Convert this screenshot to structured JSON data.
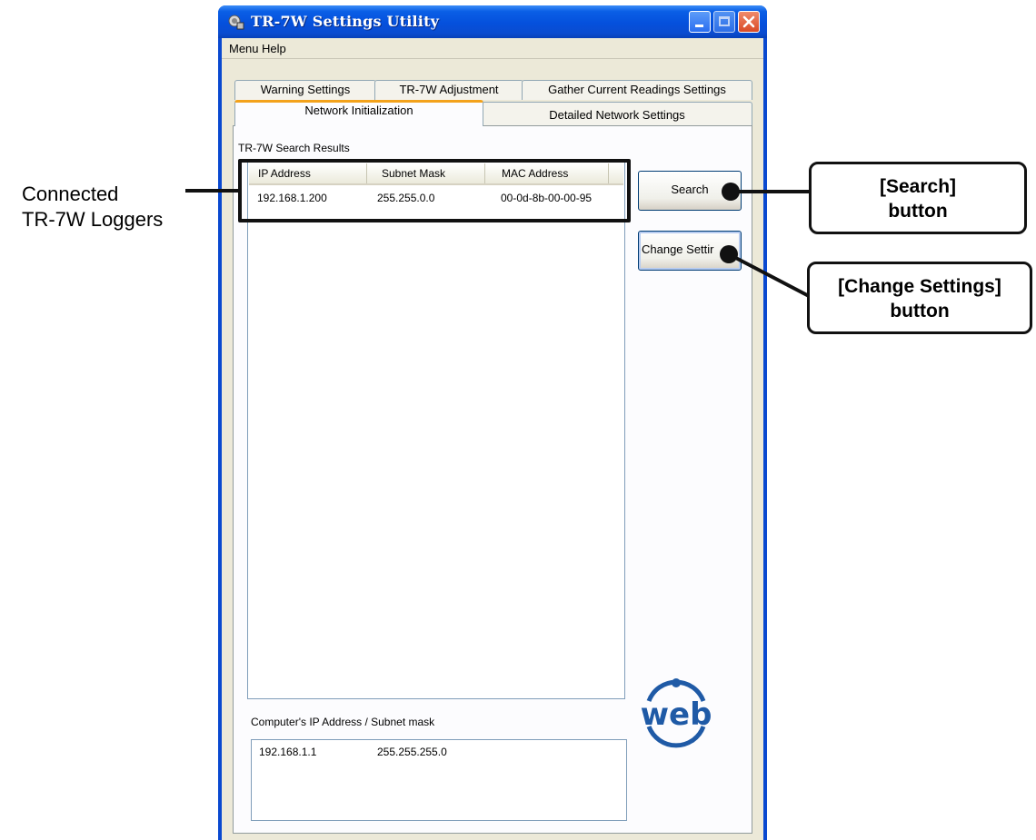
{
  "window": {
    "title": "TR-7W Settings Utility"
  },
  "menu": {
    "menu_label": "Menu",
    "help_label": "Help"
  },
  "tabs": {
    "row1": [
      {
        "label": "Warning Settings"
      },
      {
        "label": "TR-7W Adjustment"
      },
      {
        "label": "Gather Current Readings Settings"
      }
    ],
    "row2": [
      {
        "label": "Network Initialization",
        "active": true
      },
      {
        "label": "Detailed Network Settings"
      }
    ]
  },
  "search_results": {
    "label": "TR-7W Search Results",
    "columns": [
      "IP Address",
      "Subnet Mask",
      "MAC Address"
    ],
    "rows": [
      {
        "ip": "192.168.1.200",
        "subnet": "255.255.0.0",
        "mac": "00-0d-8b-00-00-95"
      }
    ]
  },
  "buttons": {
    "search": "Search",
    "change_settings": "Change Settir"
  },
  "computer": {
    "label": "Computer's IP Address /  Subnet mask",
    "ip": "192.168.1.1",
    "subnet": "255.255.255.0"
  },
  "logo": {
    "text": "web",
    "color": "#1f5aa6"
  },
  "annotations": {
    "connected_line1": "Connected",
    "connected_line2": "TR-7W Loggers",
    "search_callout_line1": "[Search]",
    "search_callout_line2": "button",
    "change_callout_line1": "[Change Settings]",
    "change_callout_line2": "button"
  },
  "colors": {
    "titlebar": "#0550dc",
    "window_border": "#0a49d0",
    "active_tab_accent": "#f3a21b",
    "close_button": "#d94a26"
  }
}
